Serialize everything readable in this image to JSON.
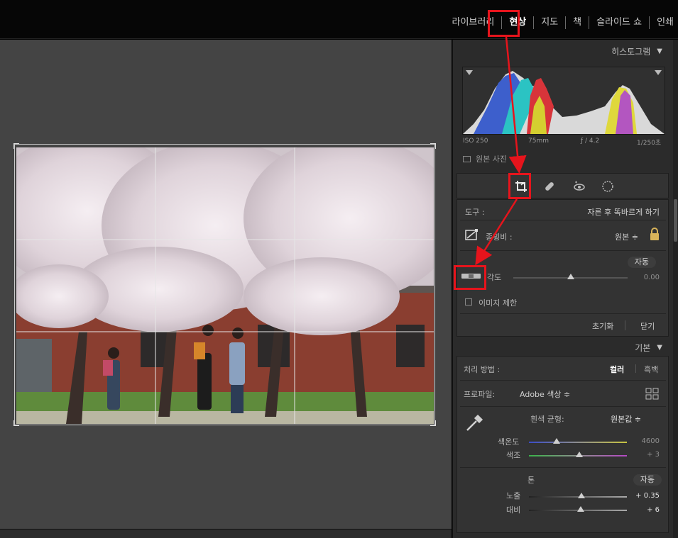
{
  "nav": {
    "modules": [
      "라이브러리",
      "현상",
      "지도",
      "책",
      "슬라이드 쇼",
      "인쇄"
    ],
    "active": "현상"
  },
  "histogram": {
    "title": "히스토그램",
    "iso": "ISO 250",
    "focal": "75mm",
    "aperture": "ƒ / 4.2",
    "shutter": "1/250초",
    "original_photo_label": "원본 사진"
  },
  "crop": {
    "tool_label": "도구 :",
    "tool_value": "자른 후 똑바르게 하기",
    "aspect_label": "종횡비 :",
    "aspect_value": "원본 ≑",
    "auto_label": "자동",
    "angle_label": "각도",
    "angle_value": "0.00",
    "constrain_label": "이미지 제한",
    "reset_label": "초기화",
    "close_label": "닫기"
  },
  "basic": {
    "title": "기본",
    "process_label": "처리 방법 :",
    "process_color": "컬러",
    "process_bw": "흑백",
    "profile_label": "프로파일:",
    "profile_value": "Adobe 색상 ≑",
    "wb_label": "흰색 균형:",
    "wb_value": "원본값 ≑",
    "temp_label": "색온도",
    "temp_value": "4600",
    "tint_label": "색조",
    "tint_value": "+ 3",
    "tone_label": "톤",
    "tone_auto": "자동",
    "exposure_label": "노출",
    "exposure_value": "+ 0.35",
    "contrast_label": "대비",
    "contrast_value": "+ 6"
  },
  "icons": {
    "crop": "crop-icon",
    "heal": "bandage-icon",
    "redeye": "eye-icon",
    "mask": "radial-mask-icon",
    "eyedropper": "eyedropper-icon",
    "lock": "lock-icon",
    "level": "level-icon"
  },
  "colors": {
    "accent_red": "#e6141c",
    "panel": "#2b2b2b",
    "canvas": "#444444"
  }
}
